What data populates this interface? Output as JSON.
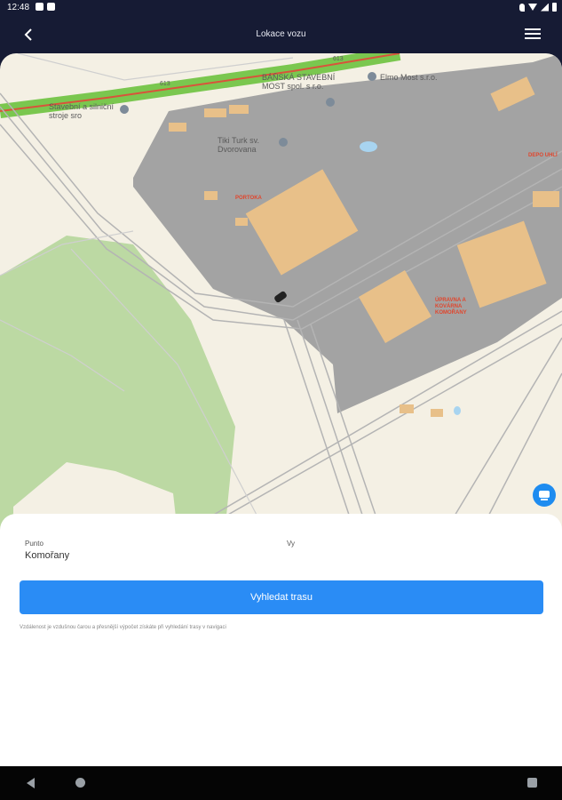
{
  "status_bar": {
    "time": "12:48"
  },
  "header": {
    "title": "Lokace vozu",
    "back_icon": "chevron-left-icon",
    "menu_icon": "hamburger-menu-icon"
  },
  "map": {
    "road_label": "613",
    "road_label_2": "613",
    "places": [
      "Stavební a silniční stroje sro",
      "BÁŇSKÁ STAVEBNÍ MOST spol. s r.o.",
      "Elmo Most s.r.o.",
      "Tiki Turk sv. Dvorovana",
      "PORTOKA"
    ],
    "red_labels": [
      "ÚPRAVNA A KOVÁRNA KOMOŘANY",
      "DEPO UHLÍ"
    ],
    "traffic_button_icon": "traffic-icon",
    "colors": {
      "land": "#f4f0e4",
      "industrial": "#a3a3a3",
      "building": "#e8c089",
      "park": "#bcd9a3",
      "highway": "#7ac74f",
      "water": "#a8d4f0"
    }
  },
  "route_form": {
    "from_label": "Punto",
    "from_value": "Komořany",
    "to_label": "Vy",
    "to_value": "",
    "search_button": "Vyhledat trasu",
    "note": "Vzdálenost je vzdušnou čarou a přesnější výpočet získáte při vyhledání trasy v navigaci"
  },
  "nav_bar": {
    "back_icon": "nav-back-icon",
    "home_icon": "nav-home-icon",
    "recents_icon": "nav-recents-icon"
  }
}
